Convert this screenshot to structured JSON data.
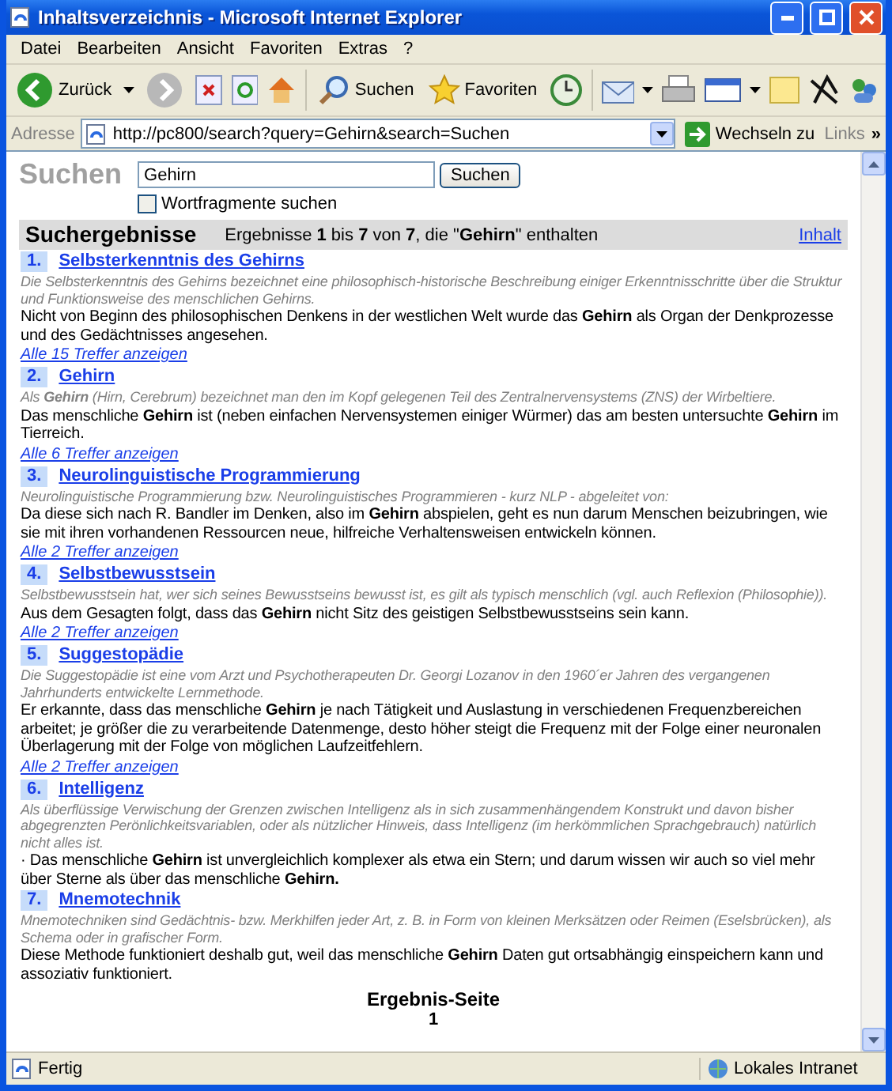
{
  "window": {
    "title": "Inhaltsverzeichnis - Microsoft Internet Explorer"
  },
  "menu": [
    "Datei",
    "Bearbeiten",
    "Ansicht",
    "Favoriten",
    "Extras",
    "?"
  ],
  "toolbar": {
    "back_label": "Zurück",
    "search_label": "Suchen",
    "favorites_label": "Favoriten"
  },
  "address_bar": {
    "label": "Adresse",
    "url": "http://pc800/search?query=Gehirn&search=Suchen",
    "go_label": "Wechseln zu",
    "links_label": "Links",
    "chevron": "»"
  },
  "search": {
    "heading": "Suchen",
    "value": "Gehirn",
    "button": "Suchen",
    "checkbox": {
      "label": "Wortfragmente suchen",
      "checked": false
    }
  },
  "results_header": {
    "title": "Suchergebnisse",
    "summary": "Ergebnisse **1** bis **7** von **7**, die \"**Gehirn**\" enthalten",
    "link": "Inhalt"
  },
  "results": [
    {
      "number": "1.",
      "title": "Selbsterkenntnis des Gehirns",
      "abstract": "Die Selbsterkenntnis des Gehirns bezeichnet eine philosophisch-historische Beschreibung einiger Erkenntnisschritte über die Struktur und Funktionsweise des menschlichen Gehirns.",
      "snippet": "Nicht von Beginn des philosophischen Denkens in der westlichen Welt wurde das **Gehirn** als Organ der Denkprozesse und des Gedächtnisses angesehen.",
      "more": "Alle 15 Treffer anzeigen"
    },
    {
      "number": "2.",
      "title": "Gehirn",
      "abstract": "Als **Gehirn** (Hirn, Cerebrum) bezeichnet man den im Kopf gelegenen Teil des Zentralnervensystems (ZNS) der Wirbeltiere.",
      "snippet": "Das menschliche **Gehirn** ist (neben einfachen Nervensystemen einiger Würmer) das am besten untersuchte **Gehirn** im Tierreich.",
      "more": "Alle 6 Treffer anzeigen"
    },
    {
      "number": "3.",
      "title": "Neurolinguistische Programmierung",
      "abstract": "Neurolinguistische Programmierung bzw. Neurolinguistisches Programmieren - kurz NLP - abgeleitet von:",
      "snippet": "Da diese sich nach R. Bandler im Denken, also im **Gehirn** abspielen, geht es nun darum Menschen beizubringen, wie sie mit ihren vorhandenen Ressourcen neue, hilfreiche Verhaltensweisen entwickeln können.",
      "more": "Alle 2 Treffer anzeigen"
    },
    {
      "number": "4.",
      "title": "Selbstbewusstsein",
      "abstract": "Selbstbewusstsein hat, wer sich seines Bewusstseins bewusst ist, es gilt als typisch menschlich (vgl. auch Reflexion (Philosophie)).",
      "snippet": "Aus dem Gesagten folgt, dass das **Gehirn** nicht Sitz des geistigen Selbstbewusstseins sein kann.",
      "more": "Alle 2 Treffer anzeigen"
    },
    {
      "number": "5.",
      "title": "Suggestopädie",
      "abstract": "Die Suggestopädie ist eine vom Arzt und Psychotherapeuten Dr. Georgi Lozanov in den 1960´er Jahren des vergangenen Jahrhunderts entwickelte Lernmethode.",
      "snippet": "Er erkannte, dass das menschliche **Gehirn** je nach Tätigkeit und Auslastung in verschiedenen Frequenzbereichen arbeitet; je größer die zu verarbeitende Datenmenge, desto höher steigt die Frequenz mit der Folge einer neuronalen Überlagerung mit der Folge von möglichen Laufzeitfehlern.",
      "more": "Alle 2 Treffer anzeigen"
    },
    {
      "number": "6.",
      "title": "Intelligenz",
      "abstract": "Als überflüssige Verwischung der Grenzen zwischen Intelligenz als in sich zusammenhängendem Konstrukt und davon bisher abgegrenzten Perönlichkeitsvariablen, oder als nützlicher Hinweis, dass Intelligenz (im herkömmlichen Sprachgebrauch) natürlich nicht alles ist.",
      "snippet": "· Das menschliche **Gehirn** ist unvergleichlich komplexer als etwa ein Stern; und darum wissen wir auch so viel mehr über Sterne als über das menschliche **Gehirn.**"
    },
    {
      "number": "7.",
      "title": "Mnemotechnik",
      "abstract": "Mnemotechniken sind Gedächtnis- bzw. Merkhilfen jeder Art, z. B. in Form von kleinen Merksätzen oder Reimen (Eselsbrücken), als Schema oder in grafischer Form.",
      "snippet": "Diese Methode funktioniert deshalb gut, weil das menschliche **Gehirn** Daten gut ortsabhängig einspeichern kann und assoziativ funktioniert."
    }
  ],
  "pager": {
    "label": "Ergebnis-Seite",
    "pages": [
      {
        "label": "1",
        "selected": true
      }
    ]
  },
  "status_bar": {
    "text": "Fertig",
    "zone": "Lokales Intranet"
  }
}
